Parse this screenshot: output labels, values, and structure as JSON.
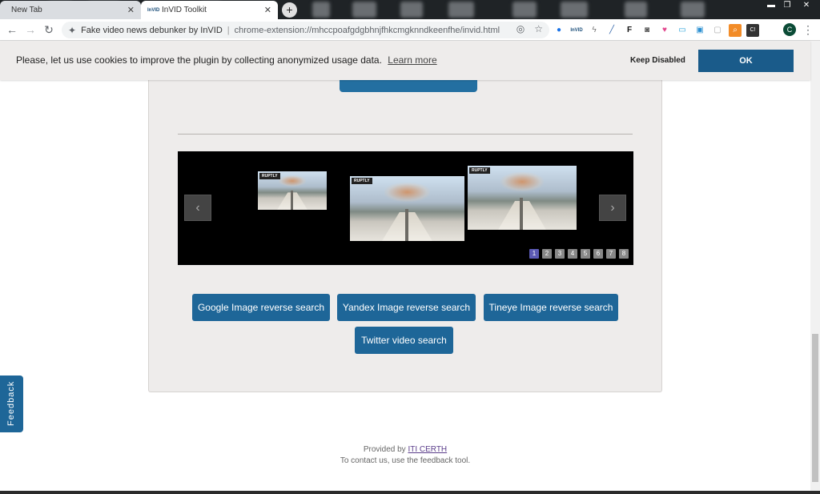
{
  "browser": {
    "tabs": [
      {
        "title": "New Tab"
      },
      {
        "title": "InVID Toolkit",
        "favicon": "InVID"
      }
    ],
    "window_controls": {
      "minimize": "▬",
      "maximize": "❐",
      "close": "✕"
    },
    "new_tab": "+",
    "omnibox": {
      "site_name": "Fake video news debunker by InVID",
      "separator": "|",
      "url": "chrome-extension://mhccpoafgdgbhnjfhkcmgknndkeenfhe/invid.html"
    },
    "extensions": [
      "InVID",
      "F",
      "C!"
    ],
    "profile_initial": "C"
  },
  "cookie_banner": {
    "message": "Please, let us use cookies to improve the plugin by collecting anonymized usage data.",
    "learn_more": "Learn more",
    "keep_disabled": "Keep Disabled",
    "ok": "OK"
  },
  "carousel": {
    "frame_badge": "RUPTLY",
    "prev": "‹",
    "next": "›",
    "pages": [
      "1",
      "2",
      "3",
      "4",
      "5",
      "6",
      "7",
      "8"
    ],
    "active_page": 1
  },
  "actions": {
    "google": "Google Image reverse search",
    "yandex": "Yandex Image reverse search",
    "tineye": "Tineye Image reverse search",
    "twitter": "Twitter video search"
  },
  "footer": {
    "provided_by": "Provided by",
    "provider_link": "ITI CERTH",
    "contact": "To contact us, use the feedback tool."
  },
  "feedback": {
    "label": "Feedback"
  },
  "colors": {
    "accent": "#1e6698",
    "active_page": "#5b5ab6"
  }
}
